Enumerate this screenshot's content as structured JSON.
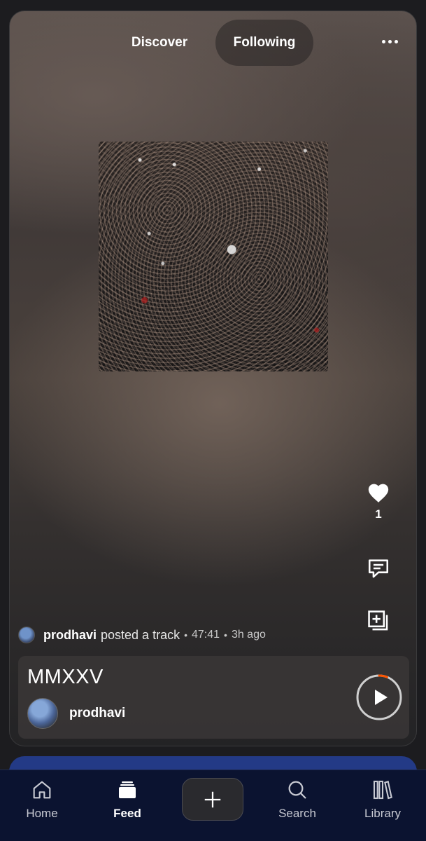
{
  "top_tabs": {
    "discover": "Discover",
    "following": "Following",
    "active": "Following"
  },
  "actions": {
    "like_count": "1",
    "icons": [
      "heart-icon",
      "comment-icon",
      "add-to-playlist-icon"
    ]
  },
  "post": {
    "poster_name": "prodhavi",
    "posted_text": "posted a track",
    "duration": "47:41",
    "age": "3h ago"
  },
  "track": {
    "title": "MMXXV",
    "artist": "prodhavi",
    "play_progress": 0.06
  },
  "bottom_nav": {
    "items": [
      {
        "label": "Home",
        "icon": "home-icon"
      },
      {
        "label": "Feed",
        "icon": "feed-icon"
      },
      {
        "label": "Search",
        "icon": "search-icon"
      },
      {
        "label": "Library",
        "icon": "library-icon"
      }
    ],
    "active": "Feed",
    "create_icon": "plus-icon"
  },
  "colors": {
    "background": "#1c1c1f",
    "nav_background": "#0b1330",
    "peek_card": "#233a86",
    "progress_accent": "#ff5500"
  }
}
